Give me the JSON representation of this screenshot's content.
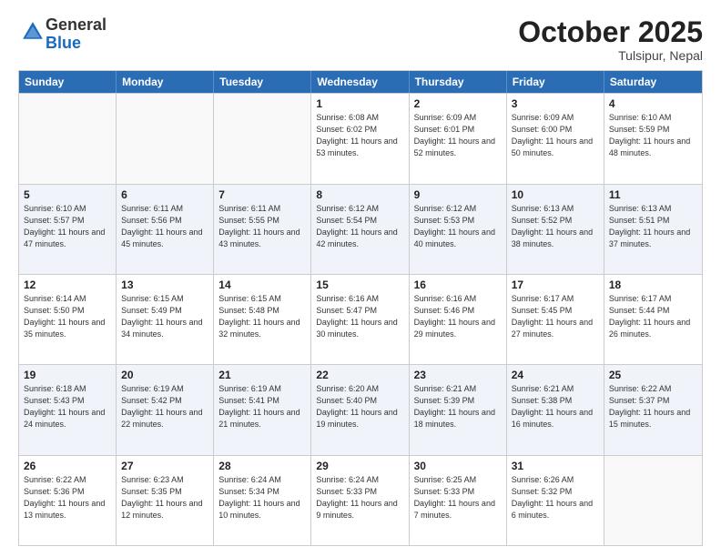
{
  "header": {
    "logo_general": "General",
    "logo_blue": "Blue",
    "month": "October 2025",
    "location": "Tulsipur, Nepal"
  },
  "days_of_week": [
    "Sunday",
    "Monday",
    "Tuesday",
    "Wednesday",
    "Thursday",
    "Friday",
    "Saturday"
  ],
  "weeks": [
    [
      {
        "day": "",
        "empty": true
      },
      {
        "day": "",
        "empty": true
      },
      {
        "day": "",
        "empty": true
      },
      {
        "day": "1",
        "sunrise": "Sunrise: 6:08 AM",
        "sunset": "Sunset: 6:02 PM",
        "daylight": "Daylight: 11 hours and 53 minutes."
      },
      {
        "day": "2",
        "sunrise": "Sunrise: 6:09 AM",
        "sunset": "Sunset: 6:01 PM",
        "daylight": "Daylight: 11 hours and 52 minutes."
      },
      {
        "day": "3",
        "sunrise": "Sunrise: 6:09 AM",
        "sunset": "Sunset: 6:00 PM",
        "daylight": "Daylight: 11 hours and 50 minutes."
      },
      {
        "day": "4",
        "sunrise": "Sunrise: 6:10 AM",
        "sunset": "Sunset: 5:59 PM",
        "daylight": "Daylight: 11 hours and 48 minutes."
      }
    ],
    [
      {
        "day": "5",
        "sunrise": "Sunrise: 6:10 AM",
        "sunset": "Sunset: 5:57 PM",
        "daylight": "Daylight: 11 hours and 47 minutes."
      },
      {
        "day": "6",
        "sunrise": "Sunrise: 6:11 AM",
        "sunset": "Sunset: 5:56 PM",
        "daylight": "Daylight: 11 hours and 45 minutes."
      },
      {
        "day": "7",
        "sunrise": "Sunrise: 6:11 AM",
        "sunset": "Sunset: 5:55 PM",
        "daylight": "Daylight: 11 hours and 43 minutes."
      },
      {
        "day": "8",
        "sunrise": "Sunrise: 6:12 AM",
        "sunset": "Sunset: 5:54 PM",
        "daylight": "Daylight: 11 hours and 42 minutes."
      },
      {
        "day": "9",
        "sunrise": "Sunrise: 6:12 AM",
        "sunset": "Sunset: 5:53 PM",
        "daylight": "Daylight: 11 hours and 40 minutes."
      },
      {
        "day": "10",
        "sunrise": "Sunrise: 6:13 AM",
        "sunset": "Sunset: 5:52 PM",
        "daylight": "Daylight: 11 hours and 38 minutes."
      },
      {
        "day": "11",
        "sunrise": "Sunrise: 6:13 AM",
        "sunset": "Sunset: 5:51 PM",
        "daylight": "Daylight: 11 hours and 37 minutes."
      }
    ],
    [
      {
        "day": "12",
        "sunrise": "Sunrise: 6:14 AM",
        "sunset": "Sunset: 5:50 PM",
        "daylight": "Daylight: 11 hours and 35 minutes."
      },
      {
        "day": "13",
        "sunrise": "Sunrise: 6:15 AM",
        "sunset": "Sunset: 5:49 PM",
        "daylight": "Daylight: 11 hours and 34 minutes."
      },
      {
        "day": "14",
        "sunrise": "Sunrise: 6:15 AM",
        "sunset": "Sunset: 5:48 PM",
        "daylight": "Daylight: 11 hours and 32 minutes."
      },
      {
        "day": "15",
        "sunrise": "Sunrise: 6:16 AM",
        "sunset": "Sunset: 5:47 PM",
        "daylight": "Daylight: 11 hours and 30 minutes."
      },
      {
        "day": "16",
        "sunrise": "Sunrise: 6:16 AM",
        "sunset": "Sunset: 5:46 PM",
        "daylight": "Daylight: 11 hours and 29 minutes."
      },
      {
        "day": "17",
        "sunrise": "Sunrise: 6:17 AM",
        "sunset": "Sunset: 5:45 PM",
        "daylight": "Daylight: 11 hours and 27 minutes."
      },
      {
        "day": "18",
        "sunrise": "Sunrise: 6:17 AM",
        "sunset": "Sunset: 5:44 PM",
        "daylight": "Daylight: 11 hours and 26 minutes."
      }
    ],
    [
      {
        "day": "19",
        "sunrise": "Sunrise: 6:18 AM",
        "sunset": "Sunset: 5:43 PM",
        "daylight": "Daylight: 11 hours and 24 minutes."
      },
      {
        "day": "20",
        "sunrise": "Sunrise: 6:19 AM",
        "sunset": "Sunset: 5:42 PM",
        "daylight": "Daylight: 11 hours and 22 minutes."
      },
      {
        "day": "21",
        "sunrise": "Sunrise: 6:19 AM",
        "sunset": "Sunset: 5:41 PM",
        "daylight": "Daylight: 11 hours and 21 minutes."
      },
      {
        "day": "22",
        "sunrise": "Sunrise: 6:20 AM",
        "sunset": "Sunset: 5:40 PM",
        "daylight": "Daylight: 11 hours and 19 minutes."
      },
      {
        "day": "23",
        "sunrise": "Sunrise: 6:21 AM",
        "sunset": "Sunset: 5:39 PM",
        "daylight": "Daylight: 11 hours and 18 minutes."
      },
      {
        "day": "24",
        "sunrise": "Sunrise: 6:21 AM",
        "sunset": "Sunset: 5:38 PM",
        "daylight": "Daylight: 11 hours and 16 minutes."
      },
      {
        "day": "25",
        "sunrise": "Sunrise: 6:22 AM",
        "sunset": "Sunset: 5:37 PM",
        "daylight": "Daylight: 11 hours and 15 minutes."
      }
    ],
    [
      {
        "day": "26",
        "sunrise": "Sunrise: 6:22 AM",
        "sunset": "Sunset: 5:36 PM",
        "daylight": "Daylight: 11 hours and 13 minutes."
      },
      {
        "day": "27",
        "sunrise": "Sunrise: 6:23 AM",
        "sunset": "Sunset: 5:35 PM",
        "daylight": "Daylight: 11 hours and 12 minutes."
      },
      {
        "day": "28",
        "sunrise": "Sunrise: 6:24 AM",
        "sunset": "Sunset: 5:34 PM",
        "daylight": "Daylight: 11 hours and 10 minutes."
      },
      {
        "day": "29",
        "sunrise": "Sunrise: 6:24 AM",
        "sunset": "Sunset: 5:33 PM",
        "daylight": "Daylight: 11 hours and 9 minutes."
      },
      {
        "day": "30",
        "sunrise": "Sunrise: 6:25 AM",
        "sunset": "Sunset: 5:33 PM",
        "daylight": "Daylight: 11 hours and 7 minutes."
      },
      {
        "day": "31",
        "sunrise": "Sunrise: 6:26 AM",
        "sunset": "Sunset: 5:32 PM",
        "daylight": "Daylight: 11 hours and 6 minutes."
      },
      {
        "day": "",
        "empty": true
      }
    ]
  ]
}
